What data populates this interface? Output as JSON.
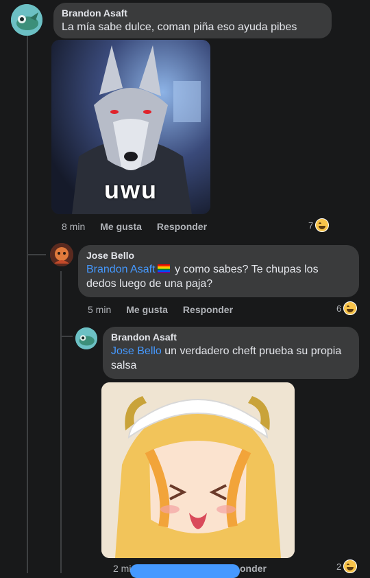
{
  "comments": [
    {
      "author": "Brandon Asaft",
      "text": "La mía sabe dulce, coman piña eso ayuda pibes",
      "image_caption": "uwu",
      "time": "8 min",
      "like": "Me gusta",
      "reply": "Responder",
      "reactions": "7"
    },
    {
      "author": "Jose Bello",
      "mention": "Brandon Asaft",
      "text": "y como sabes? Te chupas los dedos luego de una paja?",
      "time": "5 min",
      "like": "Me gusta",
      "reply": "Responder",
      "reactions": "6"
    },
    {
      "author": "Brandon Asaft",
      "mention": "Jose Bello",
      "text": "un verdadero cheft prueba su propia salsa",
      "time": "2 mi",
      "reply": "onder",
      "reactions": "2"
    }
  ],
  "colors": {
    "background": "#18191a",
    "bubble": "#3a3b3c",
    "mention": "#4599ff"
  },
  "icons": [
    "haha-reaction-icon",
    "rainbow-flag-icon"
  ]
}
